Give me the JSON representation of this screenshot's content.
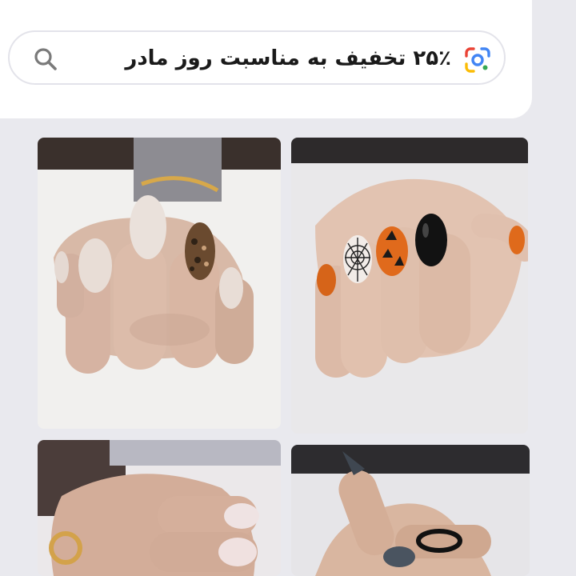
{
  "search": {
    "query": "۲۵٪ تخفیف به مناسبت روز مادر"
  },
  "icons": {
    "search": "search-icon",
    "lens": "google-lens-icon"
  },
  "colors": {
    "lens_blue": "#4285f4",
    "lens_red": "#ea4335",
    "lens_yellow": "#fbbc05",
    "lens_green": "#34a853"
  },
  "results": [
    {
      "subject": "nude almond nails with leopard accent"
    },
    {
      "subject": "halloween nails with orange, black and spider web"
    },
    {
      "subject": "pink ombre nails with gold ring"
    },
    {
      "subject": "dark grey stiletto nails with black ring"
    }
  ]
}
